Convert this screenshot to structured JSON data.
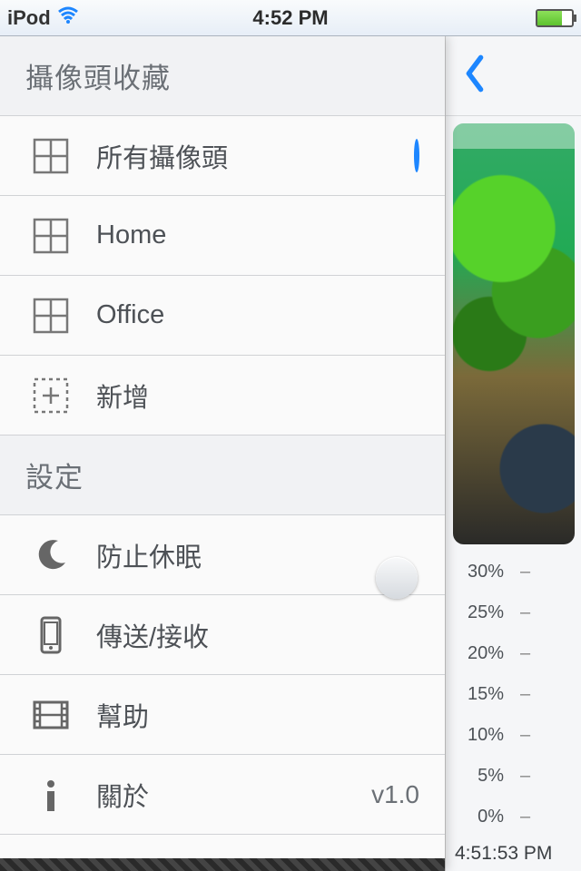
{
  "status": {
    "carrier": "iPod",
    "time": "4:52 PM"
  },
  "menu": {
    "section_cameras": "攝像頭收藏",
    "items": {
      "all": "所有攝像頭",
      "home": "Home",
      "office": "Office",
      "add": "新增"
    },
    "section_settings": "設定",
    "settings": {
      "prevent_sleep": "防止休眠",
      "transfer": "傳送/接收",
      "help": "幫助",
      "about": "關於",
      "version": "v1.0"
    }
  },
  "right": {
    "percents": [
      "30%",
      "25%",
      "20%",
      "15%",
      "10%",
      "5%",
      "0%"
    ],
    "timestamp": "4:51:53 PM"
  }
}
